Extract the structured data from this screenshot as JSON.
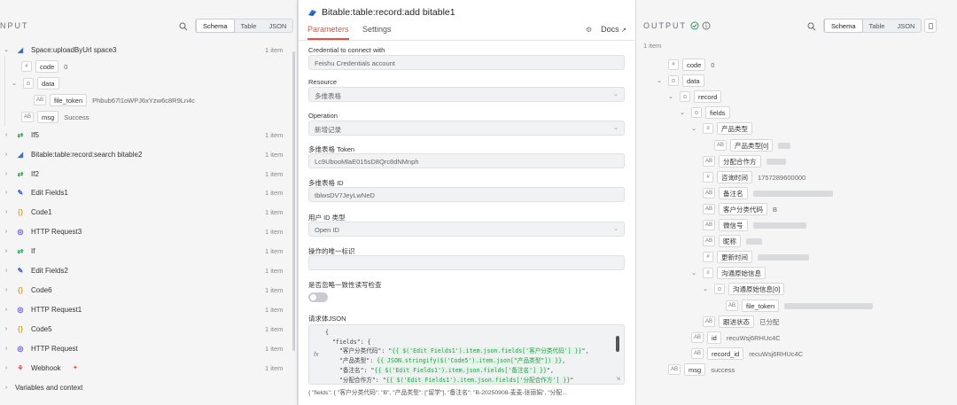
{
  "input": {
    "title": "NPUT",
    "tabs": [
      "Schema",
      "Table",
      "JSON"
    ],
    "nodes": [
      {
        "name": "Space:uploadByUrl space3",
        "items": "1 item",
        "color": "#2b76d6",
        "glyph": "◢"
      },
      {
        "name": "If5",
        "items": "1 item",
        "color": "#22a049",
        "glyph": "⇄"
      },
      {
        "name": "Bitable:table:record:search bitable2",
        "items": "1 item",
        "color": "#2b76d6",
        "glyph": "◢"
      },
      {
        "name": "If2",
        "items": "1 item",
        "color": "#22a049",
        "glyph": "⇄"
      },
      {
        "name": "Edit Fields1",
        "items": "1 item",
        "color": "#3b5bdb",
        "glyph": "✎"
      },
      {
        "name": "Code1",
        "items": "1 item",
        "color": "#e6a23c",
        "glyph": "{}"
      },
      {
        "name": "HTTP Request3",
        "items": "1 item",
        "color": "#6b4fd8",
        "glyph": "◎"
      },
      {
        "name": "If",
        "items": "1 item",
        "color": "#22a049",
        "glyph": "⇄"
      },
      {
        "name": "Edit Fields2",
        "items": "1 item",
        "color": "#3b5bdb",
        "glyph": "✎"
      },
      {
        "name": "Code6",
        "items": "1 item",
        "color": "#e6a23c",
        "glyph": "{}"
      },
      {
        "name": "HTTP Request1",
        "items": "1 item",
        "color": "#6b4fd8",
        "glyph": "◎"
      },
      {
        "name": "Code5",
        "items": "1 item",
        "color": "#e6a23c",
        "glyph": "{}"
      },
      {
        "name": "HTTP Request",
        "items": "1 item",
        "color": "#6b4fd8",
        "glyph": "◎"
      },
      {
        "name": "Webhook",
        "items": "1 item",
        "color": "#d9534f",
        "glyph": "⚘"
      }
    ],
    "sub": {
      "code_key": "code",
      "code_val": "0",
      "data_key": "data",
      "file_token_key": "file_token",
      "file_token_val": "Phbub67l1oWPJ6xYzw6c8R9Ln4c",
      "msg_key": "msg",
      "msg_val": "Success"
    },
    "variables": "Variables and context"
  },
  "center": {
    "title": "Bitable:table:record:add bitable1",
    "tab_params": "Parameters",
    "tab_settings": "Settings",
    "docs": "Docs",
    "fields": [
      {
        "label": "Credential to connect with",
        "value": "Feishu Credentials account",
        "dropdown": false
      },
      {
        "label": "Resource",
        "value": "多维表格",
        "dropdown": true
      },
      {
        "label": "Operation",
        "value": "新增记录",
        "dropdown": true
      },
      {
        "label": "多维表格 Token",
        "value": "Lc9UbooMlaE015sD8Qrc8dNMnph",
        "dropdown": false
      },
      {
        "label": "多维表格 ID",
        "value": "tblwsDV7JeyLwNeD",
        "dropdown": false
      },
      {
        "label": "用户 ID 类型",
        "value": "Open ID",
        "dropdown": true
      },
      {
        "label": "操作的唯一标识",
        "value": "",
        "dropdown": false
      }
    ],
    "toggle_label": "是否忽略一致性读写检查",
    "body_label": "请求体JSON",
    "code_lines": [
      "{",
      "  \"fields\": {",
      "    \"客户分类代码\": \"{{ $('Edit Fields1').item.json.fields['客户分类代码'] }}\",",
      "    \"产品类型\": {{ JSON.stringify($('Code5').item.json[\"产品类型\"]) }},",
      "    \"备注名\": \"{{ $('Edit Fields1').item.json.fields['备注名'] }}\",",
      "    \"分配合作方\": \"{{ $('Edit Fields1').item.json.fields['分配合作方'] }}\""
    ],
    "preview": "{ \"fields\": { \"客户分类代码\": \"B\", \"产品类型\": [\"留学\"], \"备注名\": \"B-20250908-麦麦-张丽娟\", \"分配..."
  },
  "output": {
    "title": "OUTPUT",
    "tabs": [
      "Schema",
      "Table",
      "JSON"
    ],
    "count": "1 item",
    "rows": [
      {
        "key": "code",
        "type": "#",
        "val": "0",
        "indent": 0,
        "chev": ""
      },
      {
        "key": "data",
        "type": "⊙",
        "val": "",
        "indent": 0,
        "chev": "⌄"
      },
      {
        "key": "record",
        "type": "⊙",
        "val": "",
        "indent": 1,
        "chev": "⌄"
      },
      {
        "key": "fields",
        "type": "⊙",
        "val": "",
        "indent": 2,
        "chev": "⌄"
      },
      {
        "key": "产品类型",
        "type": "≡",
        "val": "",
        "indent": 3,
        "chev": "⌄"
      },
      {
        "key": "产品类型[0]",
        "type": "AB",
        "val": "",
        "indent": 4,
        "chev": "",
        "blur": 14
      },
      {
        "key": "分配合作方",
        "type": "AB",
        "val": "",
        "indent": 3,
        "chev": "",
        "blur": 22
      },
      {
        "key": "咨询时间",
        "type": "#",
        "val": "1757289600000",
        "indent": 3,
        "chev": ""
      },
      {
        "key": "备注名",
        "type": "AB",
        "val": "",
        "indent": 3,
        "chev": "",
        "blur": 90
      },
      {
        "key": "客户分类代码",
        "type": "AB",
        "val": "B",
        "indent": 3,
        "chev": ""
      },
      {
        "key": "微信号",
        "type": "AB",
        "val": "",
        "indent": 3,
        "chev": "",
        "blur": 60
      },
      {
        "key": "昵称",
        "type": "AB",
        "val": "",
        "indent": 3,
        "chev": "",
        "blur": 18
      },
      {
        "key": "更新时间",
        "type": "#",
        "val": "",
        "indent": 3,
        "chev": "",
        "blur": 58
      },
      {
        "key": "沟通原始信息",
        "type": "≡",
        "val": "",
        "indent": 3,
        "chev": "⌄"
      },
      {
        "key": "沟通原始信息[0]",
        "type": "⊙",
        "val": "",
        "indent": 4,
        "chev": "⌄"
      },
      {
        "key": "file_token",
        "type": "AB",
        "val": "",
        "indent": 5,
        "chev": "",
        "blur": 100
      },
      {
        "key": "跟进状态",
        "type": "AB",
        "val": "已分配",
        "indent": 3,
        "chev": ""
      },
      {
        "key": "id",
        "type": "AB",
        "val": "recuWsj6RHUc4C",
        "indent": 2,
        "chev": ""
      },
      {
        "key": "record_id",
        "type": "AB",
        "val": "recuWsj6RHUc4C",
        "indent": 2,
        "chev": ""
      },
      {
        "key": "msg",
        "type": "AB",
        "val": "success",
        "indent": 0,
        "chev": ""
      }
    ]
  }
}
